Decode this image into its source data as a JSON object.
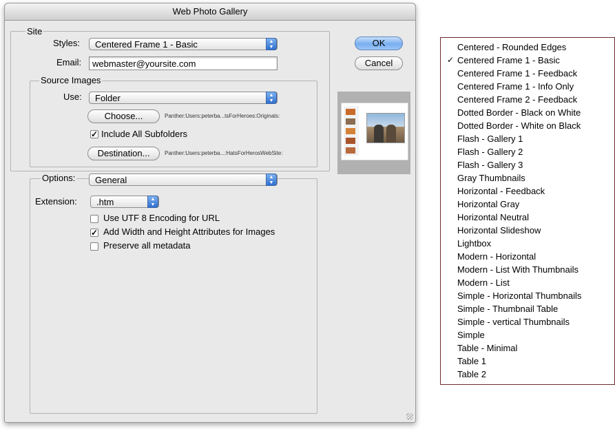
{
  "dialog": {
    "title": "Web Photo Gallery",
    "site": {
      "group_label": "Site",
      "styles_label": "Styles:",
      "styles_value": "Centered Frame 1 - Basic",
      "email_label": "Email:",
      "email_value": "webmaster@yoursite.com"
    },
    "source": {
      "group_label": "Source Images",
      "use_label": "Use:",
      "use_value": "Folder",
      "choose_label": "Choose...",
      "choose_path": "Panther:Users:peterba...tsForHeroes:Originals:",
      "include_subfolders_label": "Include All Subfolders",
      "include_subfolders_checked": true,
      "destination_label": "Destination...",
      "destination_path": "Panther:Users:peterba...:HatsForHerosWebSite:"
    },
    "options": {
      "label": "Options:",
      "value": "General",
      "extension_label": "Extension:",
      "extension_value": ".htm",
      "checkboxes": [
        {
          "label": "Use UTF 8 Encoding for URL",
          "checked": false
        },
        {
          "label": "Add Width and Height Attributes for Images",
          "checked": true
        },
        {
          "label": "Preserve all metadata",
          "checked": false
        }
      ]
    },
    "ok_label": "OK",
    "cancel_label": "Cancel"
  },
  "styles_menu": {
    "check_glyph": "✓",
    "items": [
      {
        "label": "Centered - Rounded Edges",
        "checked": false
      },
      {
        "label": "Centered Frame 1 - Basic",
        "checked": true
      },
      {
        "label": "Centered Frame 1 - Feedback",
        "checked": false
      },
      {
        "label": "Centered Frame 1 - Info Only",
        "checked": false
      },
      {
        "label": "Centered Frame 2 - Feedback",
        "checked": false
      },
      {
        "label": "Dotted Border - Black on White",
        "checked": false
      },
      {
        "label": "Dotted Border - White on Black",
        "checked": false
      },
      {
        "label": "Flash - Gallery 1",
        "checked": false
      },
      {
        "label": "Flash - Gallery 2",
        "checked": false
      },
      {
        "label": "Flash - Gallery 3",
        "checked": false
      },
      {
        "label": "Gray Thumbnails",
        "checked": false
      },
      {
        "label": "Horizontal - Feedback",
        "checked": false
      },
      {
        "label": "Horizontal Gray",
        "checked": false
      },
      {
        "label": "Horizontal Neutral",
        "checked": false
      },
      {
        "label": "Horizontal Slideshow",
        "checked": false
      },
      {
        "label": "Lightbox",
        "checked": false
      },
      {
        "label": "Modern - Horizontal",
        "checked": false
      },
      {
        "label": "Modern - List With Thumbnails",
        "checked": false
      },
      {
        "label": "Modern - List",
        "checked": false
      },
      {
        "label": "Simple - Horizontal Thumbnails",
        "checked": false
      },
      {
        "label": "Simple - Thumbnail Table",
        "checked": false
      },
      {
        "label": "Simple - vertical Thumbnails",
        "checked": false
      },
      {
        "label": "Simple",
        "checked": false
      },
      {
        "label": "Table - Minimal",
        "checked": false
      },
      {
        "label": "Table 1",
        "checked": false
      },
      {
        "label": "Table 2",
        "checked": false
      }
    ]
  },
  "colors": {
    "accent_blue": "#2f6fd0",
    "dialog_bg": "#e9e9e9",
    "menu_border": "#6b2a2a"
  }
}
